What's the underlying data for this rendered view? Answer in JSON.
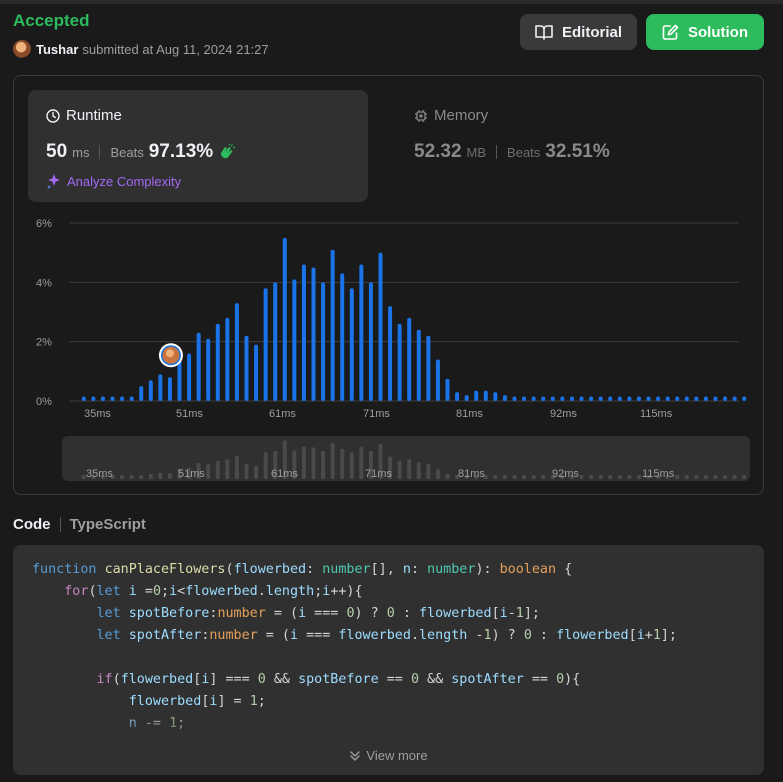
{
  "header": {
    "status": "Accepted",
    "user": "Tushar",
    "submitted_text": "submitted at Aug 11, 2024 21:27",
    "editorial_label": "Editorial",
    "solution_label": "Solution"
  },
  "runtime": {
    "title": "Runtime",
    "value": "50",
    "unit": "ms",
    "beats_label": "Beats",
    "beats_pct": "97.13%",
    "analyze_label": "Analyze Complexity"
  },
  "memory": {
    "title": "Memory",
    "value": "52.32",
    "unit": "MB",
    "beats_label": "Beats",
    "beats_pct": "32.51%"
  },
  "colors": {
    "accepted": "#2cbb5d",
    "bar": "#1a73e8",
    "analyze": "#a269f7"
  },
  "chart_data": {
    "type": "bar",
    "ylim": [
      0,
      6
    ],
    "yticks": [
      "0%",
      "2%",
      "4%",
      "6%"
    ],
    "xticks": [
      "35ms",
      "51ms",
      "61ms",
      "71ms",
      "81ms",
      "92ms",
      "115ms"
    ],
    "values": [
      0.15,
      0.15,
      0.15,
      0.15,
      0.15,
      0.15,
      0.5,
      0.7,
      0.9,
      0.8,
      1.5,
      1.6,
      2.3,
      2.1,
      2.6,
      2.8,
      3.3,
      2.2,
      1.9,
      3.8,
      4.0,
      5.5,
      4.1,
      4.6,
      4.5,
      4.0,
      5.1,
      4.3,
      3.8,
      4.6,
      4.0,
      5.0,
      3.2,
      2.6,
      2.8,
      2.4,
      2.2,
      1.4,
      0.75,
      0.3,
      0.2,
      0.35,
      0.35,
      0.3,
      0.2,
      0.15,
      0.15,
      0.15,
      0.15,
      0.15,
      0.15,
      0.15,
      0.15,
      0.15,
      0.15,
      0.15,
      0.15,
      0.15,
      0.15,
      0.15,
      0.15,
      0.15,
      0.15,
      0.15,
      0.15,
      0.15,
      0.15,
      0.15,
      0.15,
      0.15
    ],
    "highlight_index": 9,
    "grid": true
  },
  "code": {
    "tab_label": "Code",
    "language": "TypeScript",
    "view_more": "View more"
  }
}
